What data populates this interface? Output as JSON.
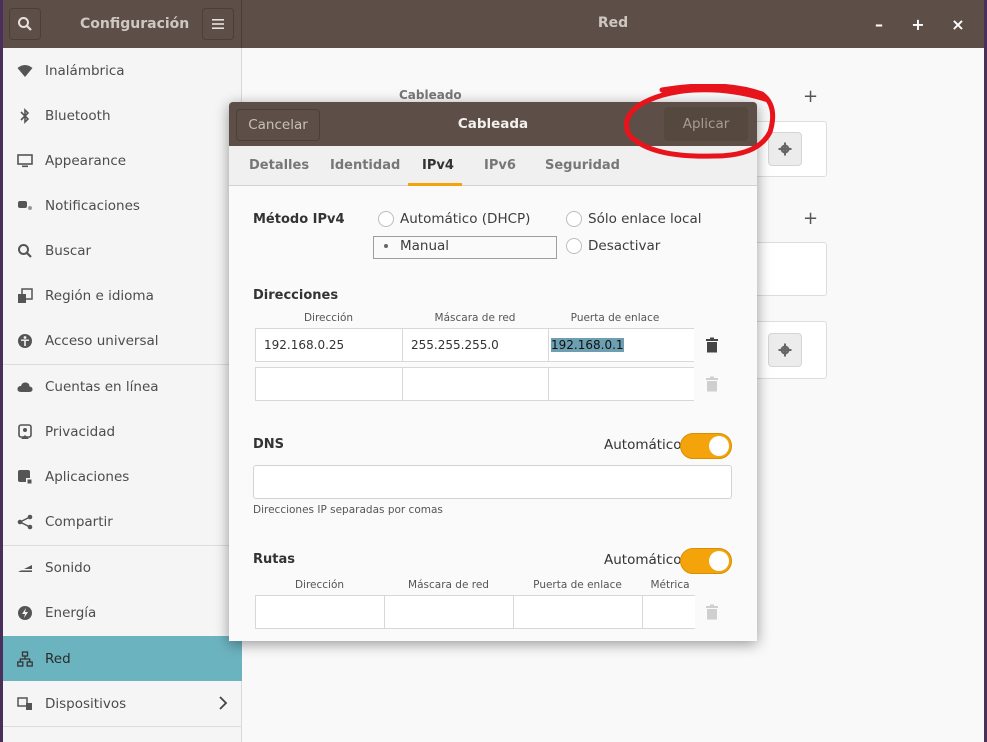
{
  "titlebar": {
    "app_title": "Configuración",
    "panel_title": "Red",
    "search_icon": "search-icon",
    "menu_icon": "hamburger-icon",
    "minimize": "–",
    "maximize": "+",
    "close": "×"
  },
  "sidebar": {
    "items": [
      {
        "label": "Inalámbrica",
        "icon": "wifi-icon"
      },
      {
        "label": "Bluetooth",
        "icon": "bluetooth-icon"
      },
      {
        "label": "Appearance",
        "icon": "display-icon"
      },
      {
        "label": "Notificaciones",
        "icon": "notifications-icon"
      },
      {
        "label": "Buscar",
        "icon": "search-icon"
      },
      {
        "label": "Región e idioma",
        "icon": "language-icon"
      },
      {
        "label": "Acceso universal",
        "icon": "accessibility-icon"
      },
      {
        "label": "Cuentas en línea",
        "icon": "cloud-icon"
      },
      {
        "label": "Privacidad",
        "icon": "privacy-icon"
      },
      {
        "label": "Aplicaciones",
        "icon": "apps-icon"
      },
      {
        "label": "Compartir",
        "icon": "share-icon"
      },
      {
        "label": "Sonido",
        "icon": "sound-icon"
      },
      {
        "label": "Energía",
        "icon": "power-icon"
      },
      {
        "label": "Red",
        "icon": "network-icon"
      },
      {
        "label": "Dispositivos",
        "icon": "devices-icon"
      }
    ],
    "active": "Red"
  },
  "background": {
    "section_label": "Cableado"
  },
  "dialog": {
    "title": "Cableada",
    "cancel_label": "Cancelar",
    "apply_label": "Aplicar",
    "tabs": [
      "Detalles",
      "Identidad",
      "IPv4",
      "IPv6",
      "Seguridad"
    ],
    "active_tab": "IPv4",
    "method": {
      "label": "Método IPv4",
      "options": [
        "Automático (DHCP)",
        "Sólo enlace local",
        "Manual",
        "Desactivar"
      ],
      "selected": "Manual"
    },
    "addresses": {
      "label": "Direcciones",
      "columns": [
        "Dirección",
        "Máscara de red",
        "Puerta de enlace"
      ],
      "rows": [
        [
          "192.168.0.25",
          "255.255.255.0",
          "192.168.0.1"
        ],
        [
          "",
          "",
          ""
        ]
      ]
    },
    "dns": {
      "label": "DNS",
      "auto_label": "Automático",
      "auto_on": true,
      "value": "",
      "hint": "Direcciones IP separadas por comas"
    },
    "routes": {
      "label": "Rutas",
      "auto_label": "Automático",
      "auto_on": true,
      "columns": [
        "Dirección",
        "Máscara de red",
        "Puerta de enlace",
        "Métrica"
      ]
    }
  },
  "colors": {
    "titlebar": "#5d4f47",
    "accent": "#f4a30a",
    "sidebar_active": "#6cb3c0",
    "annotation": "#e8141b"
  }
}
